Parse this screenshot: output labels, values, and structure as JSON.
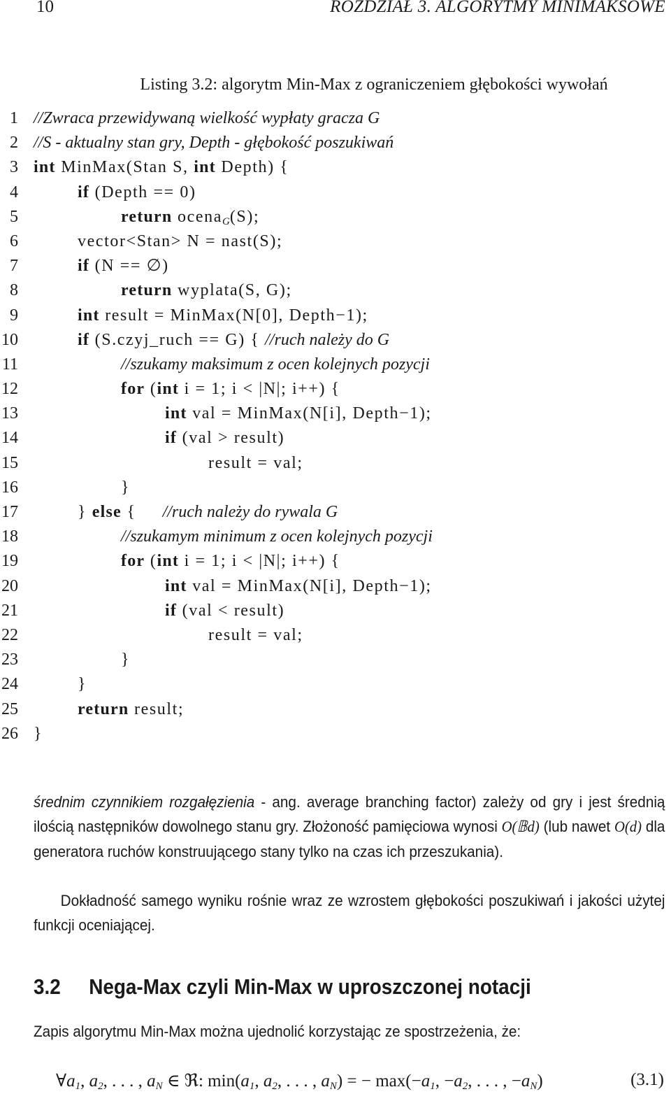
{
  "header": {
    "page_number": "10",
    "chapter_title": "ROZDZIAŁ 3.  ALGORYTMY MINIMAKSOWE"
  },
  "listing": {
    "caption": "Listing 3.2: algorytm Min-Max z ograniczeniem głębokości wywołań",
    "lines": [
      {
        "n": "1",
        "indent": 0,
        "parts": [
          {
            "t": "cm",
            "v": "//Zwraca przewidywaną wielkość wypłaty gracza G"
          }
        ]
      },
      {
        "n": "2",
        "indent": 0,
        "parts": [
          {
            "t": "cm",
            "v": "//S - aktualny stan gry, Depth - głębokość poszukiwań"
          }
        ]
      },
      {
        "n": "3",
        "indent": 0,
        "parts": [
          {
            "t": "kw",
            "v": "int"
          },
          {
            "t": "tx",
            "v": " MinMax(Stan S, "
          },
          {
            "t": "kw",
            "v": "int"
          },
          {
            "t": "tx",
            "v": " Depth) {"
          }
        ]
      },
      {
        "n": "4",
        "indent": 1,
        "parts": [
          {
            "t": "kw",
            "v": "if"
          },
          {
            "t": "tx",
            "v": " (Depth == 0)"
          }
        ]
      },
      {
        "n": "5",
        "indent": 2,
        "parts": [
          {
            "t": "kw",
            "v": "return"
          },
          {
            "t": "tx",
            "v": " ocena"
          },
          {
            "t": "sub",
            "v": "G"
          },
          {
            "t": "tx",
            "v": "(S);"
          }
        ]
      },
      {
        "n": "6",
        "indent": 1,
        "parts": [
          {
            "t": "tx",
            "v": "vector<Stan> N = nast(S);"
          }
        ]
      },
      {
        "n": "7",
        "indent": 1,
        "parts": [
          {
            "t": "kw",
            "v": "if"
          },
          {
            "t": "tx",
            "v": " (N == ∅)"
          }
        ]
      },
      {
        "n": "8",
        "indent": 2,
        "parts": [
          {
            "t": "kw",
            "v": "return"
          },
          {
            "t": "tx",
            "v": " wyplata(S, G);"
          }
        ]
      },
      {
        "n": "9",
        "indent": 1,
        "parts": [
          {
            "t": "kw",
            "v": "int"
          },
          {
            "t": "tx",
            "v": " result = MinMax(N[0], Depth−1);"
          }
        ]
      },
      {
        "n": "10",
        "indent": 1,
        "parts": [
          {
            "t": "kw",
            "v": "if"
          },
          {
            "t": "tx",
            "v": " (S.czyj_ruch == G) { "
          },
          {
            "t": "cm",
            "v": "//ruch należy do G"
          }
        ]
      },
      {
        "n": "11",
        "indent": 2,
        "parts": [
          {
            "t": "cm",
            "v": "//szukamy maksimum z ocen kolejnych pozycji"
          }
        ]
      },
      {
        "n": "12",
        "indent": 2,
        "parts": [
          {
            "t": "kw",
            "v": "for"
          },
          {
            "t": "tx",
            "v": " ("
          },
          {
            "t": "kw",
            "v": "int"
          },
          {
            "t": "tx",
            "v": " i = 1; i < |N|; i++) {"
          }
        ]
      },
      {
        "n": "13",
        "indent": 3,
        "parts": [
          {
            "t": "kw",
            "v": "int"
          },
          {
            "t": "tx",
            "v": " val = MinMax(N[i], Depth−1);"
          }
        ]
      },
      {
        "n": "14",
        "indent": 3,
        "parts": [
          {
            "t": "kw",
            "v": "if"
          },
          {
            "t": "tx",
            "v": " (val > result)"
          }
        ]
      },
      {
        "n": "15",
        "indent": 4,
        "parts": [
          {
            "t": "tx",
            "v": "result = val;"
          }
        ]
      },
      {
        "n": "16",
        "indent": 2,
        "parts": [
          {
            "t": "tx",
            "v": "}"
          }
        ]
      },
      {
        "n": "17",
        "indent": 1,
        "parts": [
          {
            "t": "tx",
            "v": "} "
          },
          {
            "t": "kw",
            "v": "else"
          },
          {
            "t": "tx",
            "v": " {     "
          },
          {
            "t": "cm",
            "v": "//ruch należy do rywala G"
          }
        ]
      },
      {
        "n": "18",
        "indent": 2,
        "parts": [
          {
            "t": "cm",
            "v": "//szukamym minimum z ocen kolejnych pozycji"
          }
        ]
      },
      {
        "n": "19",
        "indent": 2,
        "parts": [
          {
            "t": "kw",
            "v": "for"
          },
          {
            "t": "tx",
            "v": " ("
          },
          {
            "t": "kw",
            "v": "int"
          },
          {
            "t": "tx",
            "v": " i = 1; i < |N|; i++) {"
          }
        ]
      },
      {
        "n": "20",
        "indent": 3,
        "parts": [
          {
            "t": "kw",
            "v": "int"
          },
          {
            "t": "tx",
            "v": " val = MinMax(N[i], Depth−1);"
          }
        ]
      },
      {
        "n": "21",
        "indent": 3,
        "parts": [
          {
            "t": "kw",
            "v": "if"
          },
          {
            "t": "tx",
            "v": " (val < result)"
          }
        ]
      },
      {
        "n": "22",
        "indent": 4,
        "parts": [
          {
            "t": "tx",
            "v": "result = val;"
          }
        ]
      },
      {
        "n": "23",
        "indent": 2,
        "parts": [
          {
            "t": "tx",
            "v": "}"
          }
        ]
      },
      {
        "n": "24",
        "indent": 1,
        "parts": [
          {
            "t": "tx",
            "v": "}"
          }
        ]
      },
      {
        "n": "25",
        "indent": 1,
        "parts": [
          {
            "t": "kw",
            "v": "return"
          },
          {
            "t": "tx",
            "v": " result;"
          }
        ]
      },
      {
        "n": "26",
        "indent": 0,
        "parts": [
          {
            "t": "tx",
            "v": "}"
          }
        ]
      }
    ]
  },
  "paragraph1": {
    "em_term": "średnim czynnikiem rozgałęzienia",
    "text_a": " - ang. average branching factor) zależy od gry i jest średnią ilością następników dowolnego stanu gry. Złożoność pamięciowa wynosi ",
    "math_a": "O(𝔹d)",
    "text_b": " (lub nawet ",
    "math_b": "O(d)",
    "text_c": " dla generatora ruchów konstruującego stany tylko na czas ich przeszukania)."
  },
  "paragraph2": {
    "text": "Dokładność samego wyniku rośnie wraz ze wzrostem głębokości poszukiwań i jakości użytej funkcji oceniającej."
  },
  "section": {
    "number": "3.2",
    "title": "Nega-Max czyli Min-Max w uproszczonej notacji"
  },
  "paragraph3": {
    "text": "Zapis algorytmu Min-Max można ujednolić korzystając ze spostrzeżenia, że:"
  },
  "equation": {
    "lhs_prefix": "∀",
    "lhs_vars": "a",
    "set_symbol": "∈ ℜ:",
    "min_fn": "min",
    "eq_sign": "= −",
    "max_fn": "max",
    "number": "(3.1)"
  }
}
